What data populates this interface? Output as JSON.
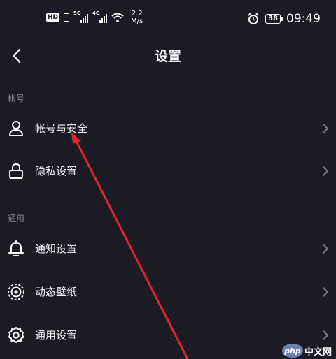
{
  "status_bar": {
    "hd_label": "HD",
    "net1_tag": "5G",
    "net2_tag": "4G",
    "speed_value": "2.2",
    "speed_unit": "M/s",
    "battery": "38",
    "time": "09:49",
    "icons": [
      "hd-icon",
      "signal-icon",
      "wifi-icon",
      "alarm-icon",
      "battery-icon"
    ]
  },
  "nav": {
    "title": "设置",
    "back_icon": "chevron-left-icon"
  },
  "sections": [
    {
      "header": "帐号",
      "items": [
        {
          "label": "帐号与安全",
          "icon": "user-icon"
        },
        {
          "label": "隐私设置",
          "icon": "lock-icon"
        }
      ]
    },
    {
      "header": "通用",
      "items": [
        {
          "label": "通知设置",
          "icon": "bell-icon"
        },
        {
          "label": "动态壁纸",
          "icon": "wallpaper-icon"
        },
        {
          "label": "通用设置",
          "icon": "gear-icon"
        }
      ]
    }
  ],
  "annotation": {
    "color": "#e0262a",
    "kind": "arrow"
  },
  "watermark": {
    "logo": "php",
    "text": "中文网"
  }
}
